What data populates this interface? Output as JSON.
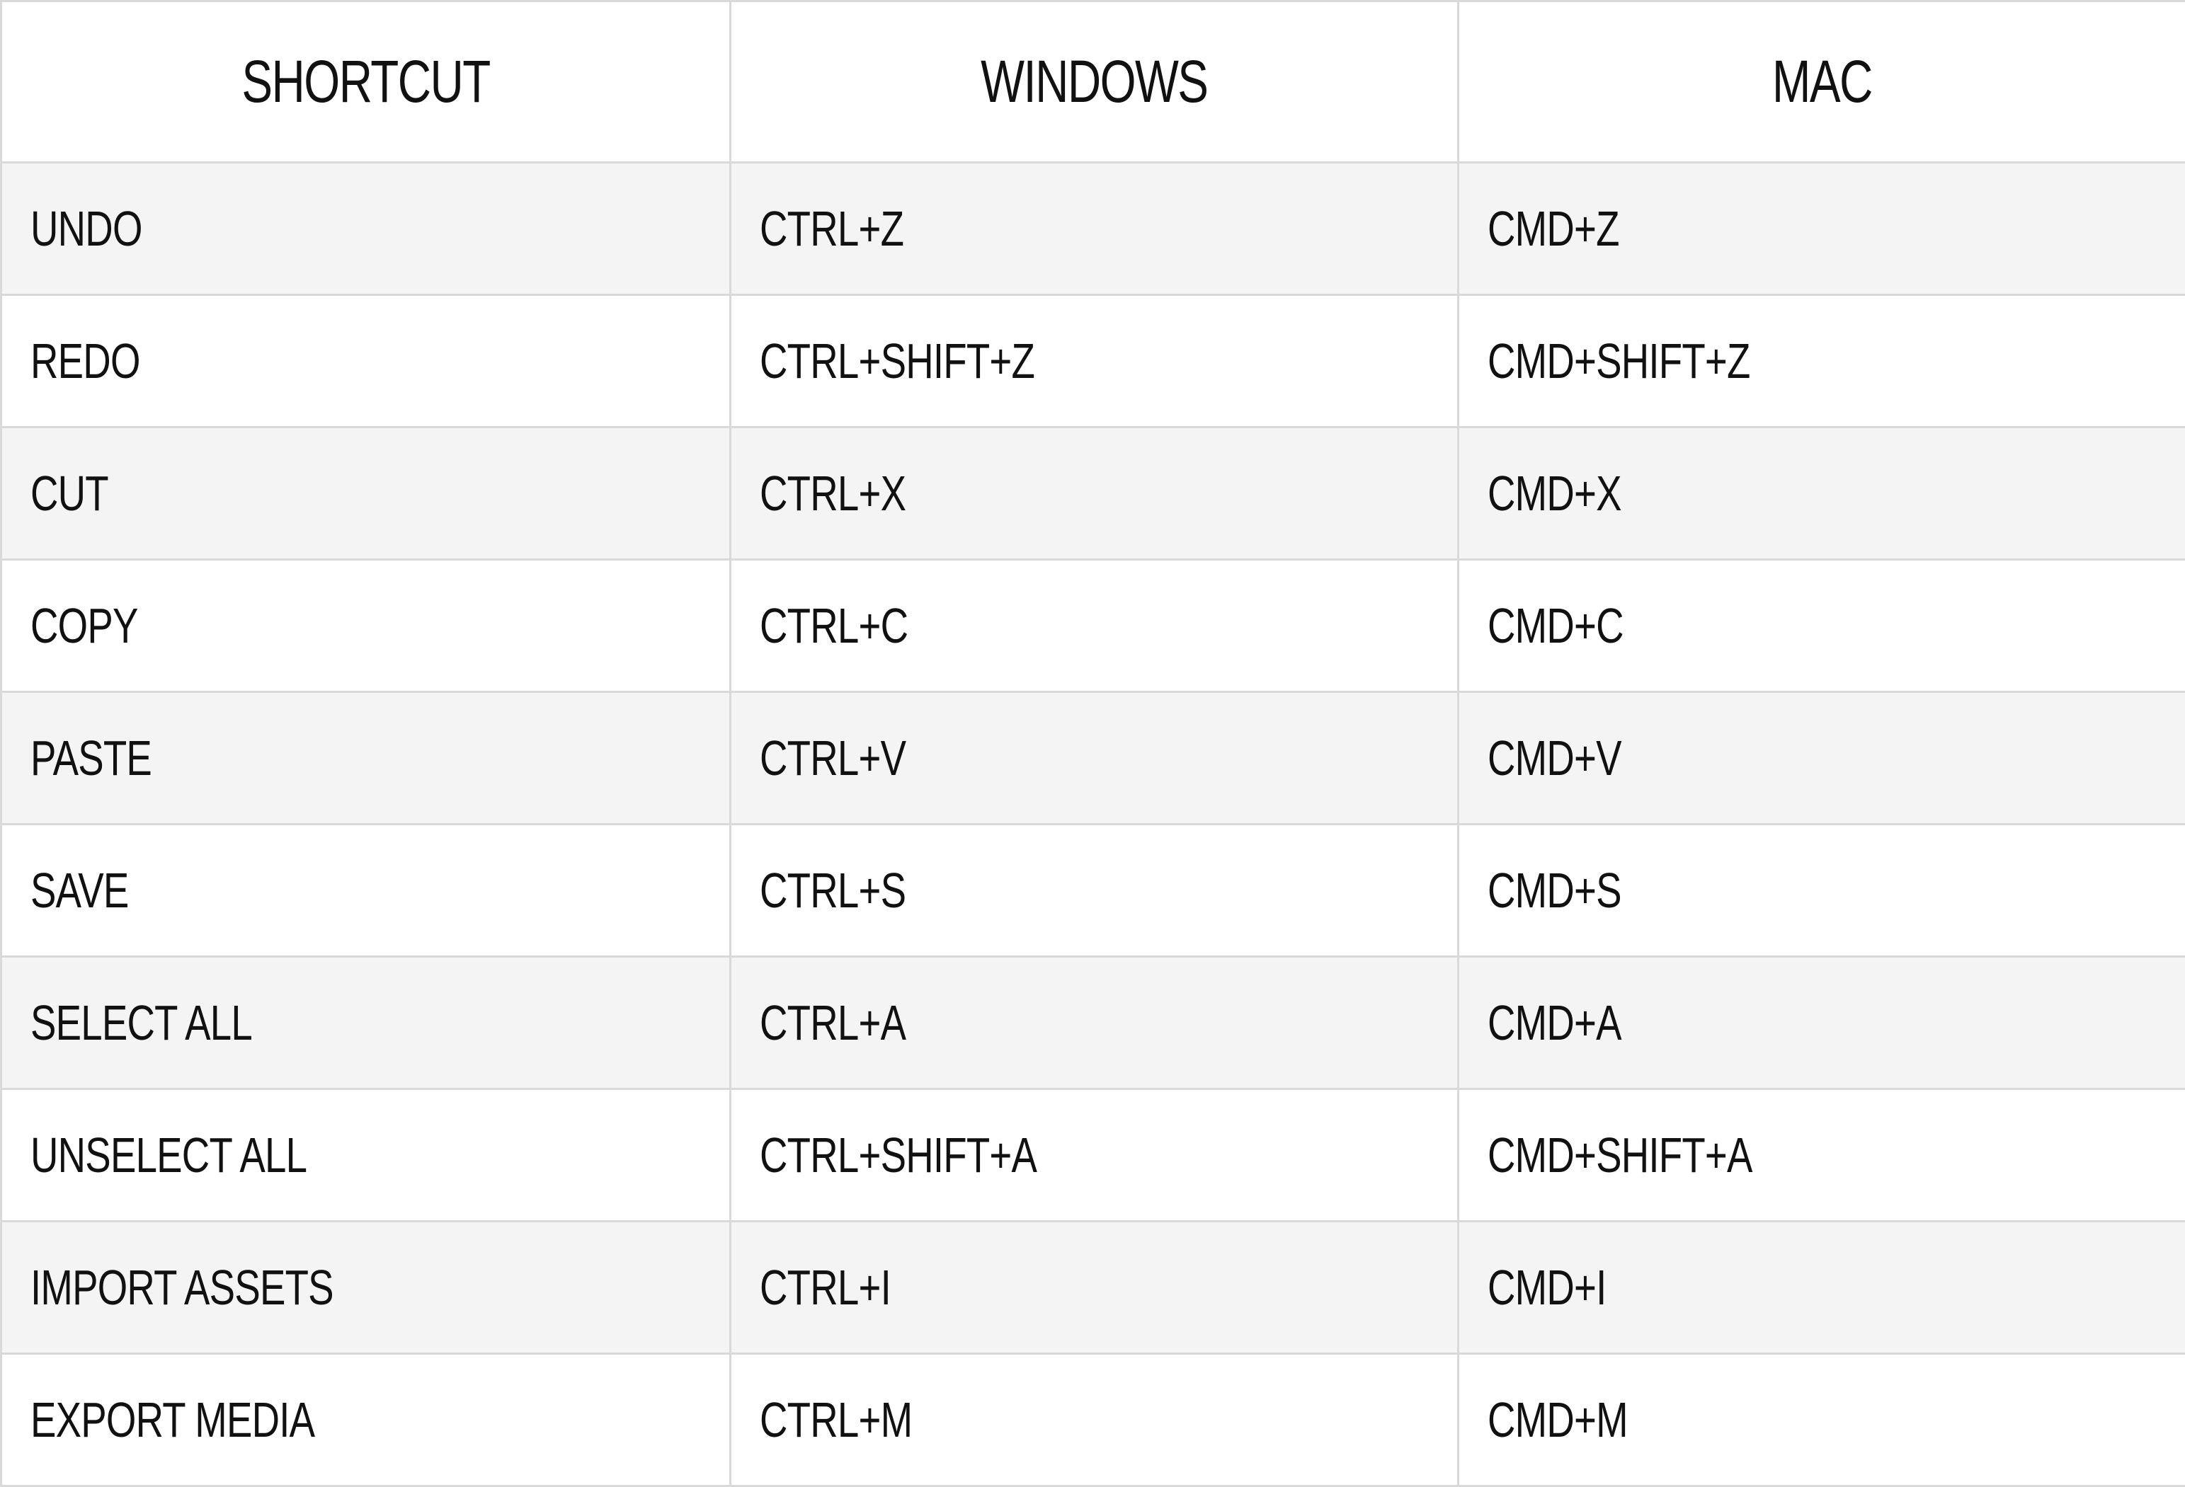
{
  "table": {
    "headers": [
      "SHORTCUT",
      "WINDOWS",
      "MAC"
    ],
    "rows": [
      [
        "UNDO",
        "CTRL+Z",
        "CMD+Z"
      ],
      [
        "REDO",
        "CTRL+SHIFT+Z",
        "CMD+SHIFT+Z"
      ],
      [
        "CUT",
        "CTRL+X",
        "CMD+X"
      ],
      [
        "COPY",
        "CTRL+C",
        "CMD+C"
      ],
      [
        "PASTE",
        "CTRL+V",
        "CMD+V"
      ],
      [
        "SAVE",
        "CTRL+S",
        "CMD+S"
      ],
      [
        "SELECT ALL",
        "CTRL+A",
        "CMD+A"
      ],
      [
        "UNSELECT ALL",
        "CTRL+SHIFT+A",
        "CMD+SHIFT+A"
      ],
      [
        "IMPORT ASSETS",
        "CTRL+I",
        "CMD+I"
      ],
      [
        "EXPORT MEDIA",
        "CTRL+M",
        "CMD+M"
      ]
    ]
  },
  "colors": {
    "border": "#d9d9d9",
    "alt_row_bg": "#f4f4f4",
    "row_bg": "#ffffff",
    "text": "#111111"
  }
}
